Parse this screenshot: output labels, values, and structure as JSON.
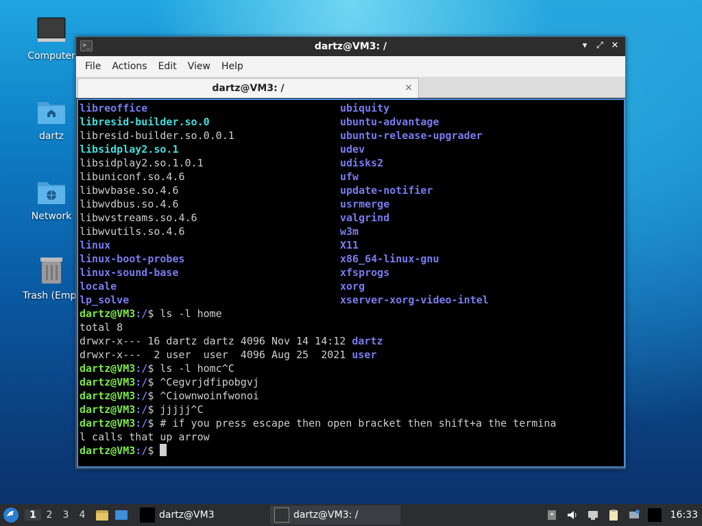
{
  "desktop": {
    "icons": [
      {
        "label": "Computer",
        "icon": "monitor-icon"
      },
      {
        "label": "dartz",
        "icon": "home-folder-icon"
      },
      {
        "label": "Network",
        "icon": "network-folder-icon"
      },
      {
        "label": "Trash (Empt",
        "icon": "trash-icon"
      }
    ]
  },
  "window": {
    "title": "dartz@VM3: /",
    "menu": [
      "File",
      "Actions",
      "Edit",
      "View",
      "Help"
    ],
    "tab_label": "dartz@VM3: /",
    "close_glyph": "×",
    "controls": {
      "minimize": "▾",
      "maximize": "⤢",
      "close": "✕"
    }
  },
  "terminal": {
    "listing": [
      {
        "left": "libreoffice",
        "left_style": "blue",
        "right": "ubiquity"
      },
      {
        "left": "libresid-builder.so.0",
        "left_style": "cyan",
        "right": "ubuntu-advantage"
      },
      {
        "left": "libresid-builder.so.0.0.1",
        "left_style": "plain",
        "right": "ubuntu-release-upgrader"
      },
      {
        "left": "libsidplay2.so.1",
        "left_style": "cyan",
        "right": "udev"
      },
      {
        "left": "libsidplay2.so.1.0.1",
        "left_style": "plain",
        "right": "udisks2"
      },
      {
        "left": "libuniconf.so.4.6",
        "left_style": "plain",
        "right": "ufw"
      },
      {
        "left": "libwvbase.so.4.6",
        "left_style": "plain",
        "right": "update-notifier"
      },
      {
        "left": "libwvdbus.so.4.6",
        "left_style": "plain",
        "right": "usrmerge"
      },
      {
        "left": "libwvstreams.so.4.6",
        "left_style": "plain",
        "right": "valgrind"
      },
      {
        "left": "libwvutils.so.4.6",
        "left_style": "plain",
        "right": "w3m"
      },
      {
        "left": "linux",
        "left_style": "blue",
        "right": "X11"
      },
      {
        "left": "linux-boot-probes",
        "left_style": "blue",
        "right": "x86_64-linux-gnu"
      },
      {
        "left": "linux-sound-base",
        "left_style": "blue",
        "right": "xfsprogs"
      },
      {
        "left": "locale",
        "left_style": "blue",
        "right": "xorg"
      },
      {
        "left": "lp_solve",
        "left_style": "blue",
        "right": "xserver-xorg-video-intel"
      }
    ],
    "prompt_user": "dartz@VM3",
    "prompt_path": ":/",
    "prompt_sign": "$ ",
    "cmd1": "ls -l home",
    "total": "total 8",
    "ls_rows": [
      {
        "text": "drwxr-x--- 16 dartz dartz 4096 Nov 14 14:12 ",
        "name": "dartz"
      },
      {
        "text": "drwxr-x---  2 user  user  4096 Aug 25  2021 ",
        "name": "user"
      }
    ],
    "cmd2": "ls -l homc^C",
    "cmd3": "^Cegvrjdfipobgvj",
    "cmd4": "^Ciownwoinfwonoi",
    "cmd5": "jjjjj^C",
    "cmd6a": "# if you press escape then open bracket then shift+a the termina",
    "cmd6b": "l calls that up arrow"
  },
  "taskbar": {
    "workspaces": [
      "1",
      "2",
      "3",
      "4"
    ],
    "tasks": [
      {
        "label": "dartz@VM3"
      },
      {
        "label": "dartz@VM3: /"
      }
    ],
    "clock": "16:33"
  }
}
